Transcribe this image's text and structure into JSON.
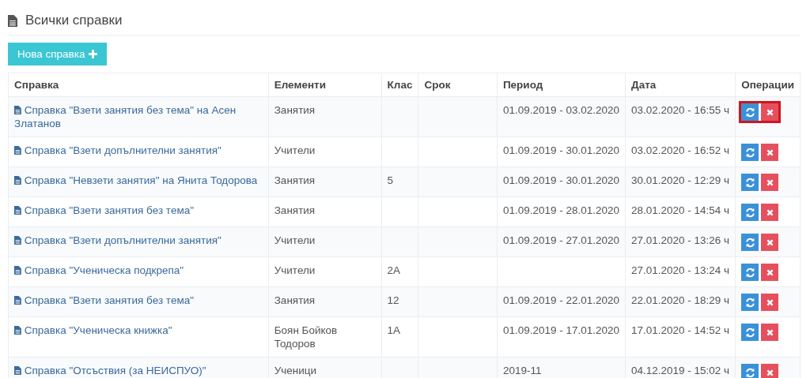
{
  "title": "Всички справки",
  "new_button": "Нова справка",
  "table": {
    "columns": [
      "Справка",
      "Елементи",
      "Клас",
      "Срок",
      "Период",
      "Дата",
      "Операции"
    ],
    "rows": [
      {
        "report": "Справка \"Взети занятия без тема\" на Асен Златанов",
        "elements": "Занятия",
        "class": "",
        "term": "",
        "period": "01.09.2019 - 03.02.2020",
        "date": "03.02.2020 - 16:55 ч",
        "highlighted": true
      },
      {
        "report": "Справка \"Взети допълнителни занятия\"",
        "elements": "Учители",
        "class": "",
        "term": "",
        "period": "01.09.2019 - 30.01.2020",
        "date": "03.02.2020 - 16:52 ч",
        "highlighted": false
      },
      {
        "report": "Справка \"Невзети занятия\" на Янита Тодорова",
        "elements": "Занятия",
        "class": "5",
        "term": "",
        "period": "01.09.2019 - 30.01.2020",
        "date": "30.01.2020 - 12:29 ч",
        "highlighted": false
      },
      {
        "report": "Справка \"Взети занятия без тема\"",
        "elements": "Занятия",
        "class": "",
        "term": "",
        "period": "01.09.2019 - 28.01.2020",
        "date": "28.01.2020 - 14:54 ч",
        "highlighted": false
      },
      {
        "report": "Справка \"Взети допълнителни занятия\"",
        "elements": "Учители",
        "class": "",
        "term": "",
        "period": "01.09.2019 - 27.01.2020",
        "date": "27.01.2020 - 13:26 ч",
        "highlighted": false
      },
      {
        "report": "Справка \"Ученическа подкрепа\"",
        "elements": "Учители",
        "class": "2А",
        "term": "",
        "period": "",
        "date": "27.01.2020 - 13:24 ч",
        "highlighted": false
      },
      {
        "report": "Справка \"Взети занятия без тема\"",
        "elements": "Занятия",
        "class": "12",
        "term": "",
        "period": "01.09.2019 - 22.01.2020",
        "date": "22.01.2020 - 18:29 ч",
        "highlighted": false
      },
      {
        "report": "Справка \"Ученическа книжка\"",
        "elements": "Боян Бойков Тодоров",
        "class": "1А",
        "term": "",
        "period": "01.09.2019 - 17.01.2020",
        "date": "17.01.2020 - 14:52 ч",
        "highlighted": false
      },
      {
        "report": "Справка \"Отсъствия (за НЕИСПУО)\"",
        "elements": "Ученици",
        "class": "",
        "term": "",
        "period": "2019-11",
        "date": "04.12.2019 - 15:02 ч",
        "highlighted": false
      }
    ]
  }
}
